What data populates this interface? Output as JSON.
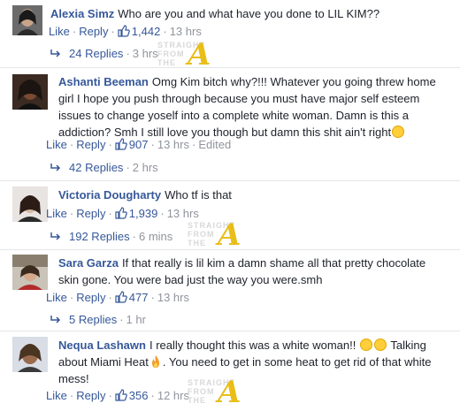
{
  "actions": {
    "like": "Like",
    "reply": "Reply",
    "dot": "·"
  },
  "watermark": {
    "line1": "STRAIGHT",
    "line2": "FROM",
    "line3": "THE",
    "letter": "A"
  },
  "comments": [
    {
      "name": "Alexia Simz",
      "text": "Who are you and what have you done to LIL KIM??",
      "likes": "1,442",
      "time": "13 hrs",
      "replies": "24 Replies",
      "replies_time": "3 hrs"
    },
    {
      "name": "Ashanti Beeman",
      "text": "Omg Kim bitch why?!!! Whatever you going threw home girl I hope you push through because you must have major self esteem issues to change yoself into a complete white woman. Damn is this a addiction? Smh I still love you though but damn this shit ain't right",
      "likes": "907",
      "time": "13 hrs",
      "edited": "Edited",
      "replies": "42 Replies",
      "replies_time": "2 hrs"
    },
    {
      "name": "Victoria Dougharty",
      "text": "Who tf is that",
      "likes": "1,939",
      "time": "13 hrs",
      "replies": "192 Replies",
      "replies_time": "6 mins"
    },
    {
      "name": "Sara Garza",
      "text": "If that really is lil kim a damn shame all that pretty chocolate skin gone. You were bad just the way you were.smh",
      "likes": "477",
      "time": "13 hrs",
      "replies": "5 Replies",
      "replies_time": "1 hr"
    },
    {
      "name": "Nequa Lashawn",
      "text": "I really thought this was a white woman!!",
      "text2": "Talking about Miami Heat",
      "text3": ". You need to get in some heat to get rid of that white mess!",
      "likes": "356",
      "time": "12 hrs"
    }
  ],
  "colors": {
    "link": "#365899",
    "meta": "#90949c",
    "text": "#1d2129"
  },
  "icons": [
    "like-thumb-icon",
    "reply-arrow-icon",
    "unamused-face-emoji",
    "flushed-face-emoji",
    "fire-emoji"
  ]
}
